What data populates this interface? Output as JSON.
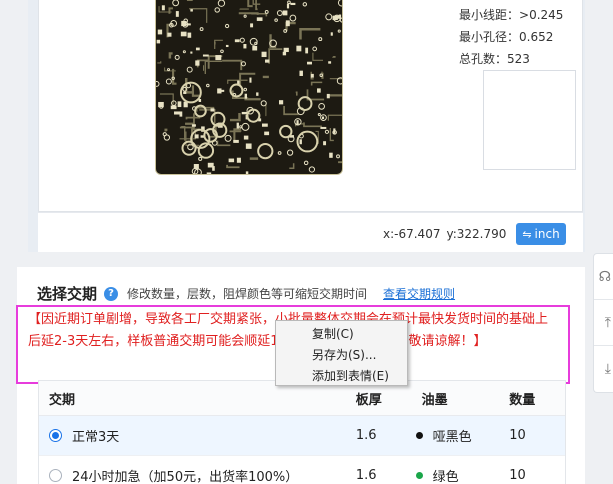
{
  "viewer": {
    "stats": [
      {
        "label": "最小线距：",
        "value": ">0.245"
      },
      {
        "label": "最小孔径：",
        "value": "0.652"
      },
      {
        "label": "总孔数：",
        "value": "523"
      }
    ],
    "coords": {
      "x": "x:-67.407",
      "y": "y:322.790"
    },
    "unit_button": {
      "icon": "swap-arrows-icon",
      "glyph": "⇋",
      "label": "inch"
    }
  },
  "delivery": {
    "title": "选择交期",
    "help_glyph": "?",
    "hint": "修改数量，层数，阻焊颜色等可缩短交期时间",
    "rules_link": "查看交期规则",
    "notice": "【因近期订单剧增，导致各工厂交期紧张，小批量整体交期会在预计最快发货时间的基础上后延2-3天左右，样板普通交期可能会顺延1-2天左右，如有不便，敬请谅解！】",
    "table": {
      "headers": {
        "name": "交期",
        "thickness": "板厚",
        "ink": "油墨",
        "qty": "数量"
      },
      "rows": [
        {
          "name": "正常3天",
          "thickness": "1.6",
          "ink": "哑黑色",
          "ink_color": "#111111",
          "qty": "10",
          "selected": true
        },
        {
          "name": "24小时加急（加50元，出货率100%）",
          "thickness": "1.6",
          "ink": "绿色",
          "ink_color": "#1aa64a",
          "qty": "10",
          "selected": false
        }
      ]
    }
  },
  "context_menu": {
    "items": [
      {
        "label": "复制(C)"
      },
      {
        "label": "另存为(S)..."
      },
      {
        "label": "添加到表情(E)"
      }
    ]
  },
  "float_toolbar": {
    "buttons": [
      {
        "icon": "headset-icon",
        "glyph": "☊"
      },
      {
        "icon": "back-to-top-icon",
        "glyph": "⤒"
      },
      {
        "icon": "collapse-icon",
        "glyph": "⤓"
      }
    ]
  },
  "colors": {
    "accent": "#3a8ee6",
    "notice_text": "#e02020",
    "notice_border": "#e73cdc",
    "link": "#1a6fd6"
  }
}
